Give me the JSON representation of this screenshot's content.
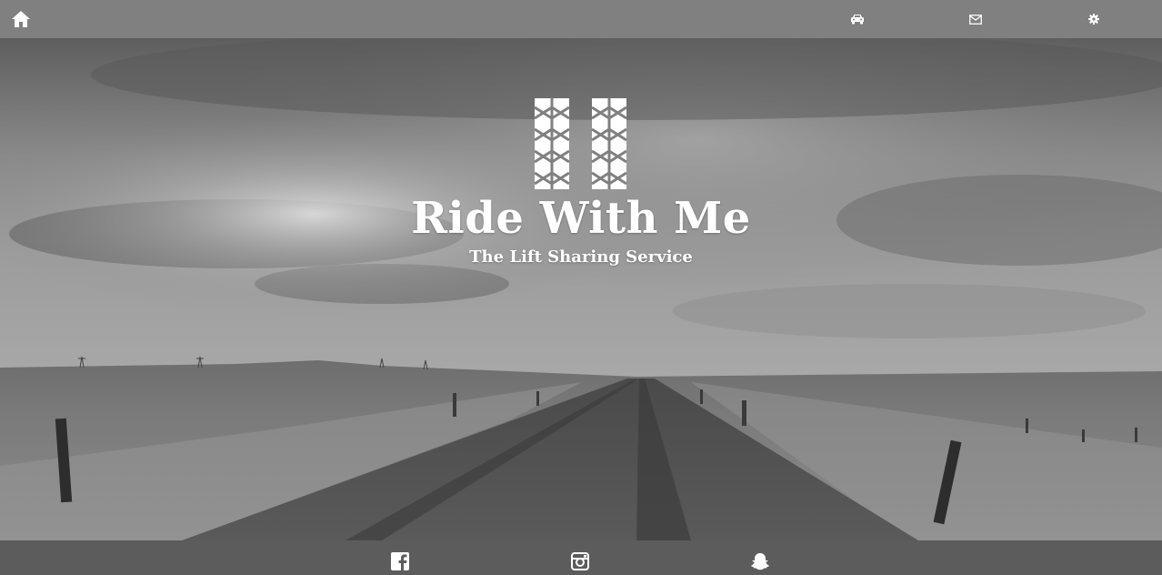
{
  "topbar": {
    "icons": {
      "home": "home-icon",
      "rides": "car-icon",
      "mail": "envelope-icon",
      "settings": "gear-icon"
    }
  },
  "hero": {
    "title": "Ride With Me",
    "tagline": "The Lift Sharing Service",
    "logo_icon": "tire-tracks-logo"
  },
  "footer": {
    "social_icons": [
      "facebook-icon",
      "instagram-icon",
      "snapchat-icon"
    ]
  },
  "colors": {
    "topbar_bg": "#808080",
    "footer_bg": "#5c5c5c",
    "text": "#ffffff"
  }
}
